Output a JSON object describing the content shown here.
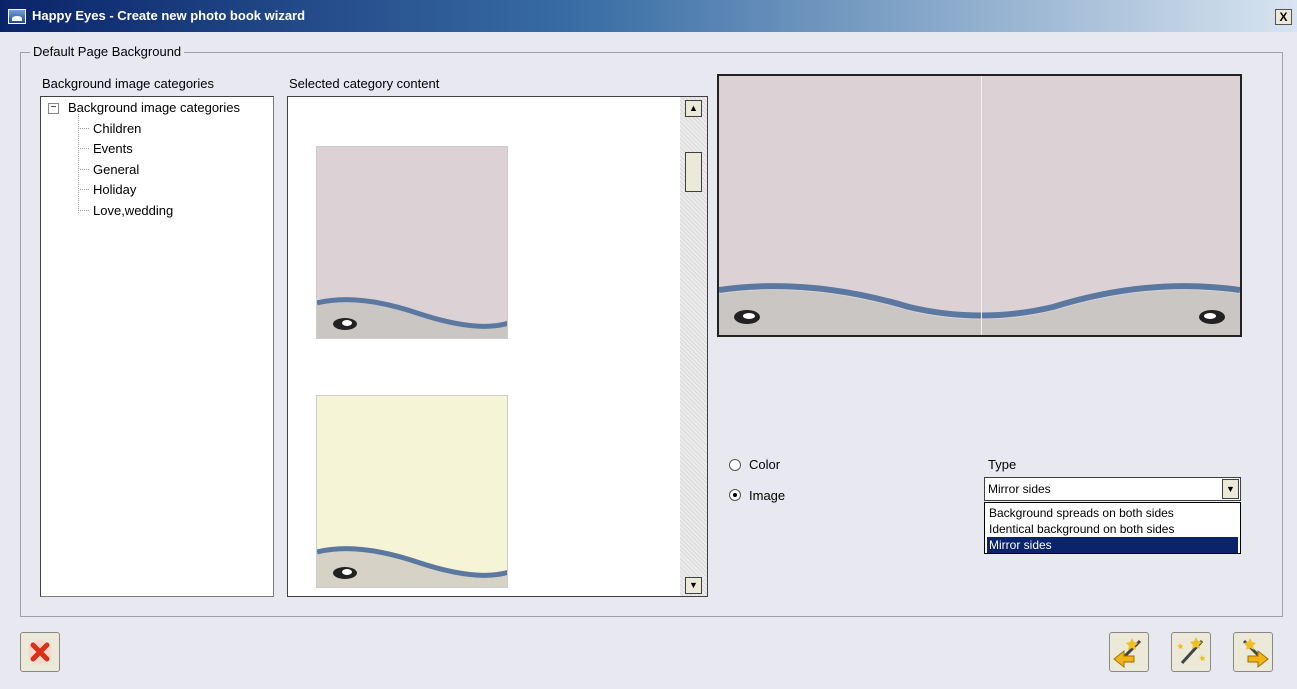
{
  "window": {
    "title": "Happy Eyes - Create new photo book wizard",
    "close_glyph": "X"
  },
  "group": {
    "legend": "Default Page Background"
  },
  "categories": {
    "header": "Background image categories",
    "root": "Background image categories",
    "items": [
      "Children",
      "Events",
      "General",
      "Holiday",
      "Love,wedding"
    ]
  },
  "content": {
    "header": "Selected category content"
  },
  "thumbnails": [
    {
      "color": "#dcd2d5"
    },
    {
      "color": "#f6f4d6"
    }
  ],
  "background_mode": {
    "options": [
      "Color",
      "Image"
    ],
    "selected": "Image"
  },
  "type": {
    "label": "Type",
    "value": "Mirror sides",
    "options": [
      "Background spreads on both sides",
      "Identical background on both sides",
      "Mirror sides"
    ]
  },
  "footer": {
    "icons": [
      "cancel-icon",
      "back-icon",
      "magic-wand-icon",
      "next-icon"
    ]
  },
  "colors": {
    "accent": "#0a246a",
    "window_bg": "#e8e8f0"
  }
}
